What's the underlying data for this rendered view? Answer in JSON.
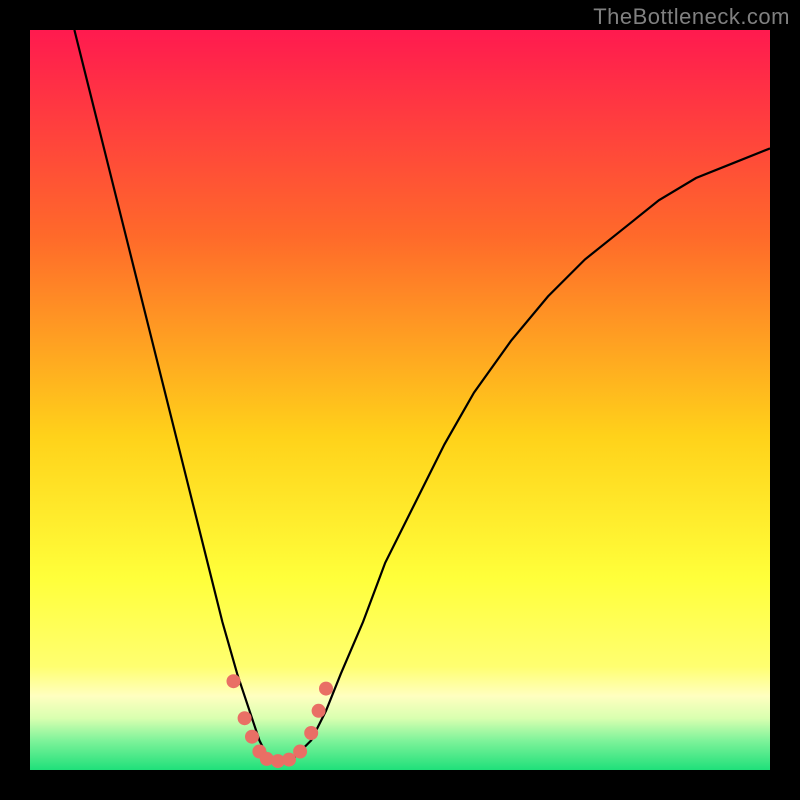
{
  "watermark": "TheBottleneck.com",
  "colors": {
    "frame": "#000000",
    "gradient_top": "#ff1a4f",
    "gradient_mid1": "#ff6a2a",
    "gradient_mid2": "#ffd21a",
    "gradient_mid3": "#ffff3a",
    "gradient_low_pale": "#ffffc0",
    "gradient_green": "#1fe07a",
    "curve": "#000000",
    "marker": "#e96f65"
  },
  "chart_data": {
    "type": "line",
    "title": "",
    "xlabel": "",
    "ylabel": "",
    "xlim": [
      0,
      100
    ],
    "ylim": [
      0,
      100
    ],
    "series": [
      {
        "name": "bottleneck-curve",
        "x": [
          6,
          8,
          10,
          12,
          14,
          16,
          18,
          20,
          22,
          24,
          26,
          28,
          30,
          31,
          32,
          33,
          34,
          35,
          36,
          38,
          40,
          42,
          45,
          48,
          52,
          56,
          60,
          65,
          70,
          75,
          80,
          85,
          90,
          95,
          100
        ],
        "y": [
          100,
          92,
          84,
          76,
          68,
          60,
          52,
          44,
          36,
          28,
          20,
          13,
          7,
          4,
          2,
          1,
          1,
          1,
          2,
          4,
          8,
          13,
          20,
          28,
          36,
          44,
          51,
          58,
          64,
          69,
          73,
          77,
          80,
          82,
          84
        ]
      }
    ],
    "markers": [
      {
        "x": 27.5,
        "y": 12
      },
      {
        "x": 29.0,
        "y": 7
      },
      {
        "x": 30.0,
        "y": 4.5
      },
      {
        "x": 31.0,
        "y": 2.5
      },
      {
        "x": 32.0,
        "y": 1.5
      },
      {
        "x": 33.5,
        "y": 1.2
      },
      {
        "x": 35.0,
        "y": 1.4
      },
      {
        "x": 36.5,
        "y": 2.5
      },
      {
        "x": 38.0,
        "y": 5
      },
      {
        "x": 39.0,
        "y": 8
      },
      {
        "x": 40.0,
        "y": 11
      }
    ],
    "optimal_band_y": [
      0,
      2.5
    ]
  }
}
